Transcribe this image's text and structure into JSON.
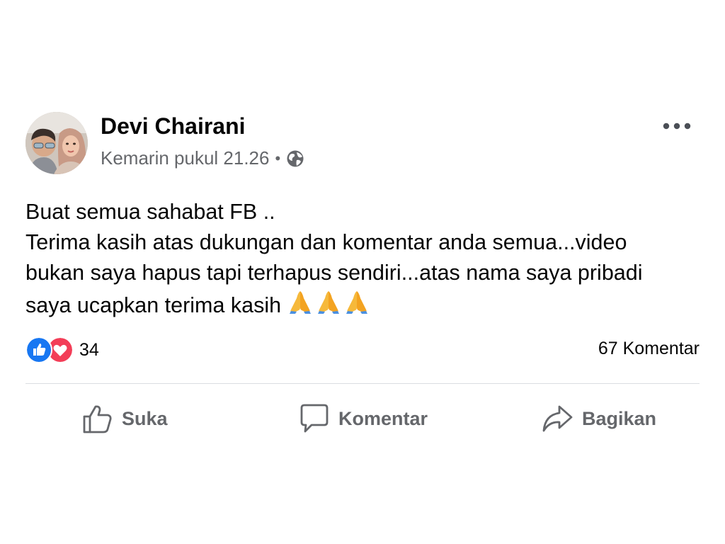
{
  "post": {
    "author": "Devi Chairani",
    "timestamp": "Kemarin pukul 21.26",
    "separator": "•",
    "privacy_icon": "globe-icon",
    "avatar_icon": "profile-photo",
    "more_icon": "more-options-icon",
    "text_lines": [
      "Buat semua sahabat FB ..",
      "Terima kasih atas dukungan dan komentar anda semua...video",
      "bukan saya hapus tapi terhapus sendiri...atas nama saya pribadi",
      "saya ucapkan terima kasih"
    ],
    "emoji": [
      "folded-hands-emoji",
      "folded-hands-emoji",
      "folded-hands-emoji"
    ]
  },
  "reactions": {
    "types": [
      "like-icon",
      "love-icon"
    ],
    "count": "34",
    "comments": "67 Komentar"
  },
  "actions": {
    "like": {
      "label": "Suka",
      "icon": "thumbs-up-icon"
    },
    "comment": {
      "label": "Komentar",
      "icon": "comment-bubble-icon"
    },
    "share": {
      "label": "Bagikan",
      "icon": "share-arrow-icon"
    }
  },
  "colors": {
    "like_blue": "#1877f2",
    "love_red": "#f33e58",
    "secondary_text": "#65676b",
    "divider": "#dadde1",
    "emoji_yellow": "#f6b93b"
  }
}
